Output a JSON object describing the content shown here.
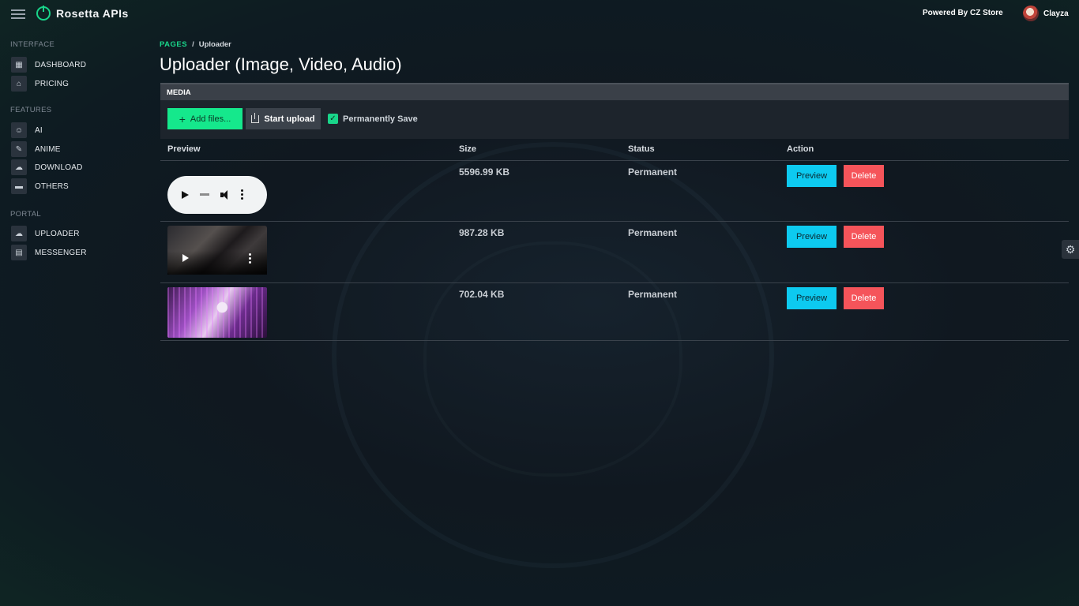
{
  "app": {
    "brand_name": "Rosetta APIs",
    "powered_by": "Powered By CZ Store",
    "user_name": "Clayza"
  },
  "sidebar": {
    "sections": [
      {
        "label": "INTERFACE",
        "items": [
          {
            "label": "DASHBOARD",
            "icon": "dashboard-icon"
          },
          {
            "label": "PRICING",
            "icon": "store-icon"
          }
        ]
      },
      {
        "label": "FEATURES",
        "items": [
          {
            "label": "AI",
            "icon": "robot-icon"
          },
          {
            "label": "ANIME",
            "icon": "anime-icon"
          },
          {
            "label": "DOWNLOAD",
            "icon": "cloud-download-icon"
          },
          {
            "label": "OTHERS",
            "icon": "folder-icon"
          }
        ]
      },
      {
        "label": "PORTAL",
        "items": [
          {
            "label": "UPLOADER",
            "icon": "cloud-upload-icon"
          },
          {
            "label": "MESSENGER",
            "icon": "chat-icon"
          }
        ]
      }
    ]
  },
  "breadcrumb": {
    "pages": "PAGES",
    "separator": "/",
    "current": "Uploader"
  },
  "page_title": "Uploader (Image, Video, Audio)",
  "media_card": {
    "header": "MEDIA",
    "add_files_label": "Add files...",
    "start_upload_label": "Start upload",
    "permanent_save_label": "Permanently Save",
    "permanent_save_checked": true
  },
  "table": {
    "columns": [
      "Preview",
      "Size",
      "Status",
      "Action"
    ],
    "rows": [
      {
        "type": "audio",
        "size": "5596.99 KB",
        "status": "Permanent",
        "preview_label": "Preview",
        "delete_label": "Delete"
      },
      {
        "type": "video",
        "size": "987.28 KB",
        "status": "Permanent",
        "preview_label": "Preview",
        "delete_label": "Delete"
      },
      {
        "type": "image",
        "size": "702.04 KB",
        "status": "Permanent",
        "preview_label": "Preview",
        "delete_label": "Delete"
      }
    ]
  },
  "colors": {
    "accent_green": "#15e88c",
    "preview_button": "#0dcaf0",
    "delete_button": "#f5545a"
  }
}
